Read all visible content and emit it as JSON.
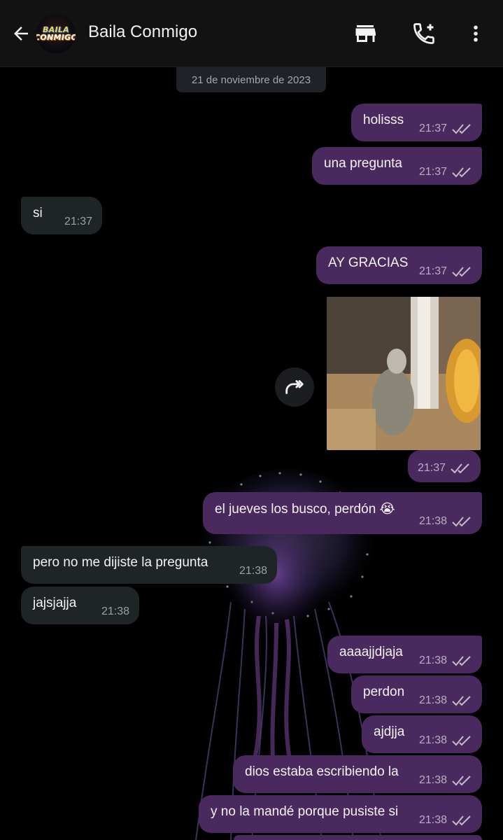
{
  "header": {
    "title": "Baila Conmigo",
    "avatar_text_line1": "BAILA",
    "avatar_text_line2": "CONMIGO"
  },
  "date_divider": "21 de noviembre de 2023",
  "messages": [
    {
      "direction": "out",
      "text": "holisss",
      "time": "21:37",
      "status": "read"
    },
    {
      "direction": "out",
      "text": "una pregunta",
      "time": "21:37",
      "status": "read"
    },
    {
      "direction": "in",
      "text": "si",
      "time": "21:37"
    },
    {
      "direction": "out",
      "text": "AY GRACIAS",
      "time": "21:37",
      "status": "read"
    },
    {
      "direction": "out",
      "type": "gif",
      "time": "21:37",
      "status": "read"
    },
    {
      "direction": "out",
      "text": "el jueves los busco, perdón 😭",
      "time": "21:38",
      "status": "read"
    },
    {
      "direction": "in",
      "text": "pero no me dijiste la pregunta",
      "time": "21:38"
    },
    {
      "direction": "in",
      "text": "jajsjajja",
      "time": "21:38"
    },
    {
      "direction": "out",
      "text": "aaaajjdjaja",
      "time": "21:38",
      "status": "read"
    },
    {
      "direction": "out",
      "text": "perdon",
      "time": "21:38",
      "status": "read"
    },
    {
      "direction": "out",
      "text": "ajdjja",
      "time": "21:38",
      "status": "read"
    },
    {
      "direction": "out",
      "text": "dios estaba escribiendo la",
      "time": "21:38",
      "status": "read"
    },
    {
      "direction": "out",
      "text": "y no la mandé porque pusiste si",
      "time": "21:38",
      "status": "read"
    }
  ],
  "icons": {
    "back": "arrow-left-icon",
    "store": "store-icon",
    "add_call": "add-call-icon",
    "menu": "more-vert-icon",
    "forward": "forward-icon",
    "read_receipt": "double-check-icon"
  },
  "colors": {
    "outgoing_bubble": "#4a2a5e",
    "incoming_bubble": "#1f2427",
    "header_bg": "#121212",
    "background": "#000000"
  }
}
